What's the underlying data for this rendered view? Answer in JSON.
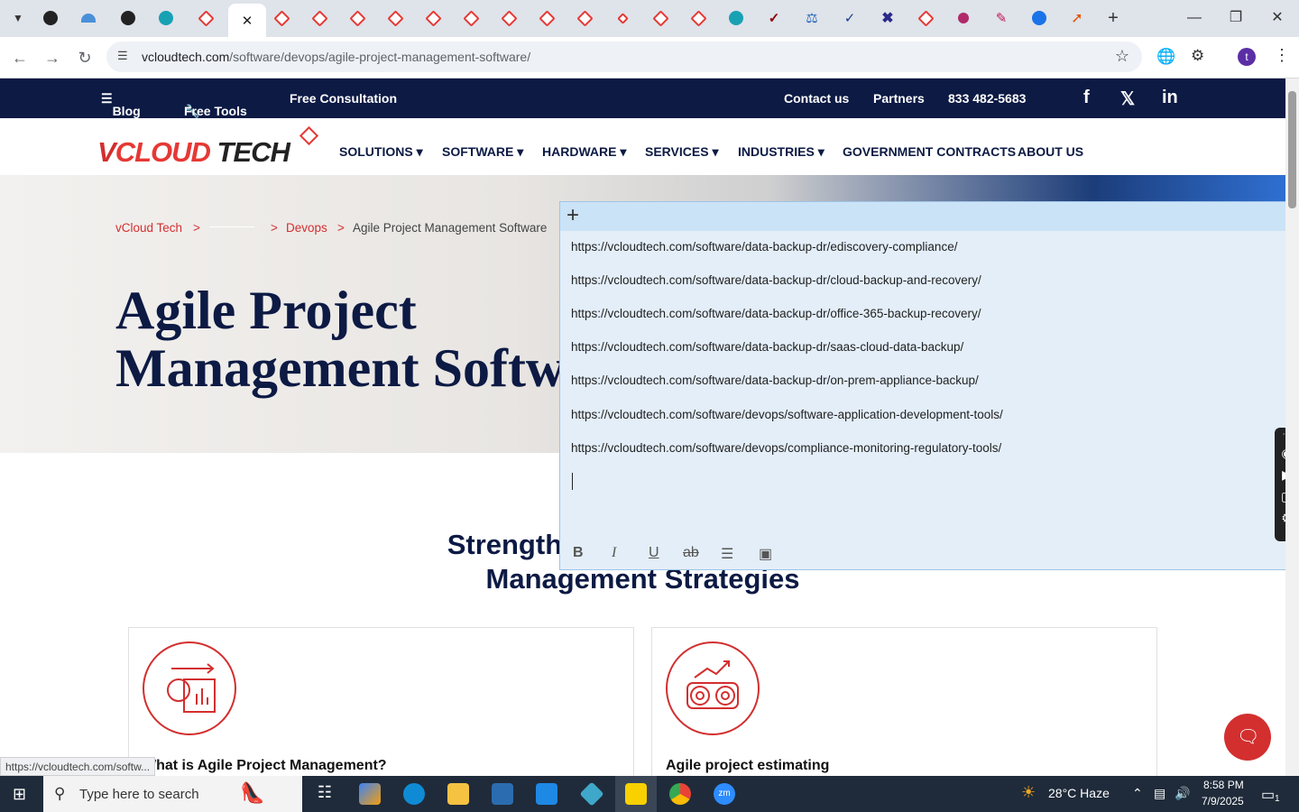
{
  "browser": {
    "url_domain": "vcloudtech.com",
    "url_path": "/software/devops/agile-project-management-software/",
    "new_tab_symbol": "+",
    "profile_initial": "t"
  },
  "topbar": {
    "blog": "Blog",
    "free_tools": "Free Tools",
    "free_consultation": "Free Consultation",
    "contact": "Contact us",
    "partners": "Partners",
    "phone": "833 482-5683"
  },
  "logo": {
    "part1": "V",
    "part2": "CLOUD",
    "part3": " TECH"
  },
  "nav": {
    "solutions": "SOLUTIONS",
    "software": "SOFTWARE",
    "hardware": "HARDWARE",
    "services": "SERVICES",
    "industries": "INDUSTRIES",
    "gov": "GOVERNMENT CONTRACTS",
    "about": "ABOUT US"
  },
  "breadcrumb": {
    "home": "vCloud Tech",
    "sep": ">",
    "devops": "Devops",
    "current": "Agile Project Management Software"
  },
  "hero": {
    "title": "Agile Project Management Software"
  },
  "section": {
    "heading_line1": "Strengthen",
    "heading_line2": "Management Strategies"
  },
  "cards": [
    {
      "title": "What is Agile Project Management?"
    },
    {
      "title": "Agile project estimating"
    }
  ],
  "sticky_note": {
    "lines": [
      "https://vcloudtech.com/software/data-backup-dr/ediscovery-compliance/",
      "https://vcloudtech.com/software/data-backup-dr/cloud-backup-and-recovery/",
      "https://vcloudtech.com/software/data-backup-dr/office-365-backup-recovery/",
      "https://vcloudtech.com/software/data-backup-dr/saas-cloud-data-backup/",
      "https://vcloudtech.com/software/data-backup-dr/on-prem-appliance-backup/",
      "https://vcloudtech.com/software/devops/software-application-development-tools/",
      "https://vcloudtech.com/software/devops/compliance-monitoring-regulatory-tools/"
    ],
    "add_symbol": "+"
  },
  "status_url": "https://vcloudtech.com/softw...",
  "taskbar": {
    "search_placeholder": "Type here to search",
    "weather": "28°C  Haze",
    "time": "8:58 PM",
    "date": "7/9/2025",
    "notification_count": "1"
  },
  "colors": {
    "brand_navy": "#0c1a44",
    "brand_red": "#d32f2f",
    "sticky_bg": "#e3eef9"
  }
}
